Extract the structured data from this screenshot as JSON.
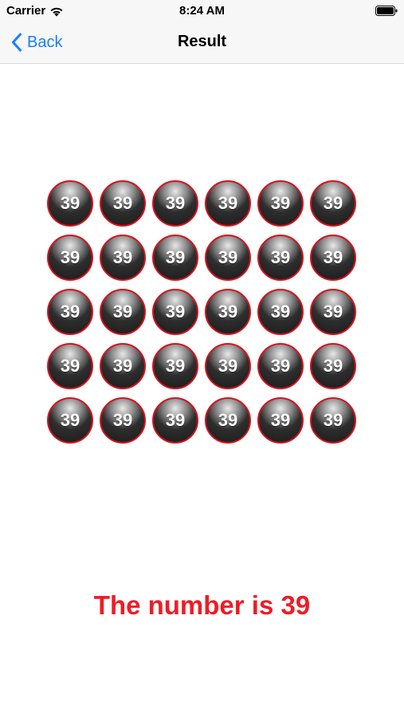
{
  "status_bar": {
    "carrier": "Carrier",
    "time": "8:24 AM",
    "wifi_icon": "wifi-icon",
    "battery_icon": "battery-icon"
  },
  "nav": {
    "back_label": "Back",
    "back_icon": "chevron-left-icon",
    "title": "Result"
  },
  "colors": {
    "accent_blue": "#1a7ff7",
    "ball_border": "#d8121c",
    "result_red": "#ee1c25"
  },
  "balls": {
    "rows": 5,
    "columns": 6,
    "values": [
      [
        "39",
        "39",
        "39",
        "39",
        "39",
        "39"
      ],
      [
        "39",
        "39",
        "39",
        "39",
        "39",
        "39"
      ],
      [
        "39",
        "39",
        "39",
        "39",
        "39",
        "39"
      ],
      [
        "39",
        "39",
        "39",
        "39",
        "39",
        "39"
      ],
      [
        "39",
        "39",
        "39",
        "39",
        "39",
        "39"
      ]
    ]
  },
  "result": {
    "text": "The number is 39"
  }
}
